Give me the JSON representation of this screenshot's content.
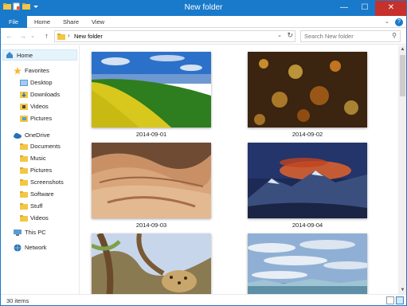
{
  "window": {
    "title": "New folder",
    "minimize_glyph": "—",
    "maximize_glyph": "☐",
    "close_glyph": "✕"
  },
  "ribbon": {
    "tabs": [
      "File",
      "Home",
      "Share",
      "View"
    ],
    "caret_glyph": "⌄",
    "help_glyph": "?"
  },
  "address": {
    "path": "New folder",
    "separator": "›",
    "dropdown_glyph": "⌄",
    "refresh_glyph": "↻"
  },
  "nav_buttons": {
    "back": "←",
    "forward": "→",
    "recent": "⌄",
    "up": "↑"
  },
  "search": {
    "placeholder": "Search New folder",
    "icon_glyph": "⚲"
  },
  "navpane": {
    "home": "Home",
    "favorites": "Favorites",
    "favorites_items": [
      "Desktop",
      "Downloads",
      "Videos",
      "Pictures"
    ],
    "onedrive": "OneDrive",
    "onedrive_items": [
      "Documents",
      "Music",
      "Pictures",
      "Screenshots",
      "Software",
      "Stuff",
      "Videos"
    ],
    "thispc": "This PC",
    "network": "Network"
  },
  "files": [
    {
      "name": "2014-09-01",
      "scene": "field"
    },
    {
      "name": "2014-09-02",
      "scene": "city"
    },
    {
      "name": "2014-09-03",
      "scene": "badlands"
    },
    {
      "name": "2014-09-04",
      "scene": "mountain"
    },
    {
      "name": "",
      "scene": "leopard"
    },
    {
      "name": "",
      "scene": "sky"
    }
  ],
  "status": {
    "count": "30 items"
  },
  "scroll": {
    "up_glyph": "▲",
    "down_glyph": "▼"
  },
  "colors": {
    "accent": "#1979ca",
    "close": "#c7312b",
    "selected": "#e5f3fb"
  }
}
